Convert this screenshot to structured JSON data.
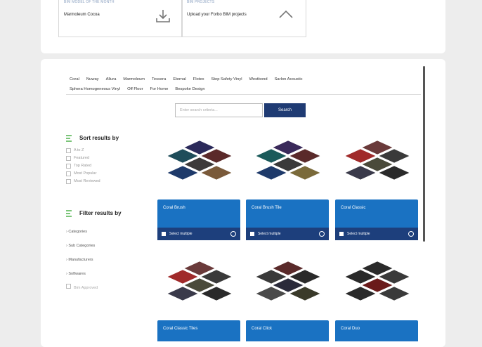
{
  "bim": {
    "model_kicker": "BIM MODEL OF THE MONTH",
    "model_text": "Marmoleum Cocoa",
    "projects_kicker": "BIM PROJECTS",
    "projects_text": "Upload your Forbo BIM projects"
  },
  "nav": {
    "row1": [
      "Coral",
      "Nuway",
      "Allura",
      "Marmoleum",
      "Tessera",
      "Eternal",
      "Flotex",
      "Step Safety Vinyl",
      "Westbond",
      "Sarlon Acoustic"
    ],
    "row2": [
      "Sphera Homogeneous Vinyl",
      "Off Floor",
      "For Home",
      "Bespoke Design"
    ]
  },
  "search": {
    "placeholder": "Enter search criteria...",
    "button": "Search"
  },
  "sort": {
    "heading": "Sort results by",
    "options": [
      "A to Z",
      "Featured",
      "Top Rated",
      "Most Popular",
      "Most Reviewed"
    ]
  },
  "filter": {
    "heading": "Filter results by",
    "options": [
      "Categories",
      "Sub Categories",
      "Manufacturers",
      "Softwares"
    ],
    "extra": "Bim Approved"
  },
  "tiles": [
    {
      "title": "Coral Brush",
      "select": "Select multiple",
      "colors": [
        "#2b2a5a",
        "#5b2a2a",
        "#1f4d5a",
        "#3d3a3a",
        "#7a5a3a",
        "#1e3a6a"
      ]
    },
    {
      "title": "Coral Brush Tile",
      "select": "Select multiple",
      "colors": [
        "#3a2a5a",
        "#5a2a2a",
        "#1a5a5a",
        "#3a3a3a",
        "#7a6a3a",
        "#1e3a6a"
      ]
    },
    {
      "title": "Coral Classic",
      "select": "Select multiple",
      "colors": [
        "#6a3a3a",
        "#3a3a3a",
        "#a02a2a",
        "#4a4a3a",
        "#2a2a2a",
        "#3a3a4a"
      ]
    },
    {
      "title": "Coral Classic Tiles",
      "select": "",
      "colors": [
        "#6a3a3a",
        "#3a3a3a",
        "#a02a2a",
        "#4a4a3a",
        "#2a2a2a",
        "#3a3a4a"
      ]
    },
    {
      "title": "Coral Click",
      "select": "",
      "colors": [
        "#5a2a2a",
        "#2a2a2a",
        "#3a3a3a",
        "#2a2a3a",
        "#3a3a2a",
        "#4a4a4a"
      ]
    },
    {
      "title": "Coral Duo",
      "select": "",
      "colors": [
        "#2a2a2a",
        "#3a3a3a",
        "#2a2a2a",
        "#6a1a1a",
        "#3a3a3a",
        "#2a2a2a"
      ]
    }
  ]
}
